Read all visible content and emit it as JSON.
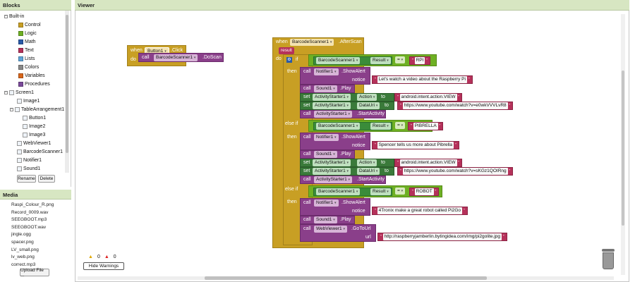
{
  "panels": {
    "blocks": "Blocks",
    "viewer": "Viewer",
    "media": "Media"
  },
  "tree": [
    {
      "label": "Built-in",
      "icon": "minus-toggle-icon"
    },
    {
      "label": "Control",
      "color": "#c89f24"
    },
    {
      "label": "Logic",
      "color": "#6eb023"
    },
    {
      "label": "Math",
      "color": "#2a5aa8"
    },
    {
      "label": "Text",
      "color": "#b5315a"
    },
    {
      "label": "Lists",
      "color": "#5fa4d8"
    },
    {
      "label": "Colors",
      "color": "#888888"
    },
    {
      "label": "Variables",
      "color": "#d8661b"
    },
    {
      "label": "Procedures",
      "color": "#7a4a9a"
    },
    {
      "label": "Screen1"
    },
    {
      "label": "Image1"
    },
    {
      "label": "TableArrangement1"
    },
    {
      "label": "Button1"
    },
    {
      "label": "Image2"
    },
    {
      "label": "Image3"
    },
    {
      "label": "WebViewer1"
    },
    {
      "label": "BarcodeScanner1"
    },
    {
      "label": "Notifier1"
    },
    {
      "label": "Sound1"
    }
  ],
  "buttons": {
    "rename": "Rename",
    "delete": "Delete",
    "upload": "Upload File ...",
    "hide_warnings": "Hide Warnings"
  },
  "media": [
    "Raspi_Colour_R.png",
    "Record_0009.wav",
    "SEEGBOOT.mp3",
    "SEEGBOOT.wav",
    "jingle.ogg",
    "spacer.png",
    "LV_small.png",
    "lv_web.png",
    "correct.mp3"
  ],
  "warnings": {
    "warn_count": "0",
    "error_count": "0"
  },
  "block1": {
    "when": "when",
    "comp": "Button1",
    "event": ".Click",
    "do": "do",
    "call": "call",
    "target": "BarcodeScanner1",
    "method": ".DoScan"
  },
  "block2": {
    "when": "when",
    "comp": "BarcodeScanner1",
    "event": ".AfterScan",
    "param": "result",
    "do": "do",
    "if": "if",
    "then": "then",
    "elseif": "else if",
    "call": "call",
    "set": "set",
    "to": "to",
    "result_get": "Result",
    "eq": "=",
    "notifier": "Notifier1",
    "showalert": ".ShowAlert",
    "notice": "notice",
    "sound": "Sound1",
    "play": ".Play",
    "activity": "ActivityStarter1",
    "action": "Action",
    "datauri": "DataUri",
    "startactivity": ".StartActivity",
    "scanner": "BarcodeScanner1",
    "webviewer": "WebViewer1",
    "gotourl": ".GoToUrl",
    "url": "url",
    "c1": "RPI",
    "n1": "Let's watch a video about the Raspberry Pi",
    "a1": "android.intent.action.VIEW",
    "u1": "https://www.youtube.com/watch?v=e0wkVVVLvR8",
    "c2": "PIBRELLA",
    "n2": "Spencer tells us more about Pibrella",
    "a2": "android.intent.action.VIEW",
    "u2": "https://www.youtube.com/watch?v=sKGz1QOIRng",
    "c3": "ROBOT",
    "n3": "4Tronix make a great robot called Pi2Go",
    "u3": "http://raspberryjamberlin.bytingidea.com/img/pi2golite.jpg"
  }
}
